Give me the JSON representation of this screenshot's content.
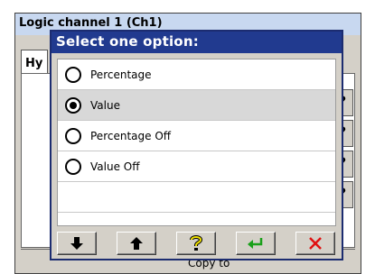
{
  "background_window": {
    "title": "Logic channel 1 (Ch1)",
    "tab_label": "Hy",
    "help_glyph": "?",
    "footer_text": "Copy to"
  },
  "dialog": {
    "title": "Select one option:",
    "options": [
      {
        "label": "Percentage",
        "selected": false
      },
      {
        "label": "Value",
        "selected": true
      },
      {
        "label": "Percentage Off",
        "selected": false
      },
      {
        "label": "Value Off",
        "selected": false
      }
    ],
    "toolbar": {
      "buttons": [
        {
          "name": "down",
          "icon": "arrow-down-icon"
        },
        {
          "name": "up",
          "icon": "arrow-up-icon"
        },
        {
          "name": "help",
          "icon": "question-icon"
        },
        {
          "name": "ok",
          "icon": "enter-icon"
        },
        {
          "name": "cancel",
          "icon": "close-icon"
        }
      ]
    }
  },
  "colors": {
    "title_bar": "#213a8f",
    "selected_row": "#d8d8d8",
    "help_yellow": "#f0e000",
    "enter_green": "#1aa01a",
    "cancel_red": "#e01010"
  }
}
